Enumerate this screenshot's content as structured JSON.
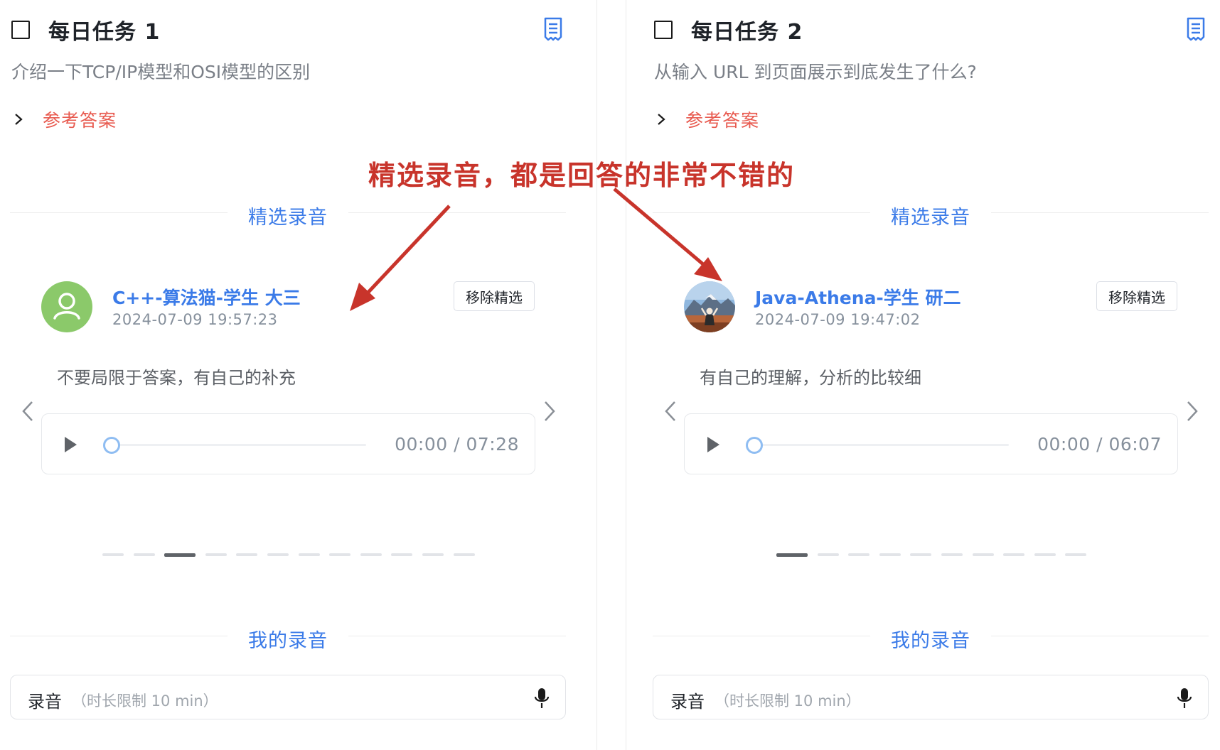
{
  "annotation": {
    "text": "精选录音，都是回答的非常不错的",
    "color": "#c8342b"
  },
  "theme": {
    "accent": "#3b7be8",
    "answer_link": "#e85a4f",
    "avatar_green": "#8bc96a"
  },
  "tasks": [
    {
      "title": "每日任务 1",
      "question": "介绍一下TCP/IP模型和OSI模型的区别",
      "answer_link": "参考答案",
      "featured_heading": "精选录音",
      "featured": {
        "user_name": "C++-算法猫-学生 大三",
        "timestamp": "2024-07-09 19:57:23",
        "remove_button": "移除精选",
        "comment": "不要局限于答案，有自己的补充",
        "player_time": "00:00 / 07:28",
        "progress": 0,
        "avatar_icon": "user-icon"
      },
      "pagination": {
        "total": 12,
        "active_index": 2
      },
      "mine_heading": "我的录音",
      "record": {
        "label": "录音",
        "hint": "（时长限制 10 min）"
      }
    },
    {
      "title": "每日任务 2",
      "question": "从输入 URL 到页面展示到底发生了什么?",
      "answer_link": "参考答案",
      "featured_heading": "精选录音",
      "featured": {
        "user_name": "Java-Athena-学生 研二",
        "timestamp": "2024-07-09 19:47:02",
        "remove_button": "移除精选",
        "comment": "有自己的理解，分析的比较细",
        "player_time": "00:00 / 06:07",
        "progress": 0,
        "avatar_icon": "photo-avatar"
      },
      "pagination": {
        "total": 10,
        "active_index": 0
      },
      "mine_heading": "我的录音",
      "record": {
        "label": "录音",
        "hint": "（时长限制 10 min）"
      }
    }
  ]
}
